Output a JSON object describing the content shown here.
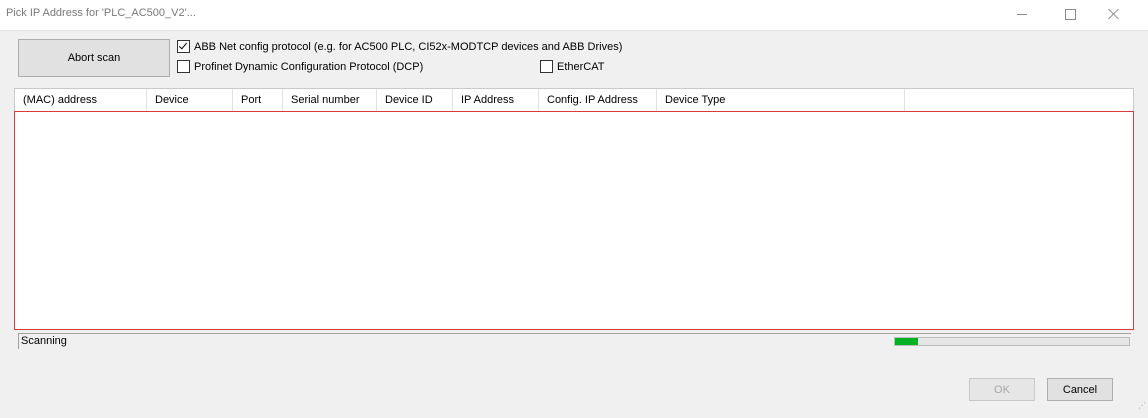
{
  "window": {
    "title": "Pick IP Address for 'PLC_AC500_V2'...",
    "controls": [
      "minimize",
      "maximize",
      "close"
    ]
  },
  "toolbar": {
    "abort_label": "Abort scan"
  },
  "protocols": {
    "abb_label": "ABB Net config protocol (e.g. for AC500 PLC, CI52x-MODTCP devices and ABB Drives)",
    "abb_checked": true,
    "dcp_label": "Profinet Dynamic Configuration Protocol (DCP)",
    "dcp_checked": false,
    "ethercat_label": "EtherCAT",
    "ethercat_checked": false
  },
  "table": {
    "columns": [
      "(MAC) address",
      "Device",
      "Port",
      "Serial number",
      "Device ID",
      "IP Address",
      "Config. IP Address",
      "Device Type"
    ],
    "rows": []
  },
  "status": {
    "text": "Scanning",
    "progress_fraction": 0.1
  },
  "footer": {
    "ok_label": "OK",
    "ok_enabled": false,
    "cancel_label": "Cancel"
  },
  "colors": {
    "progress": "#06b025",
    "list_highlight_border": "#d93b3b"
  }
}
